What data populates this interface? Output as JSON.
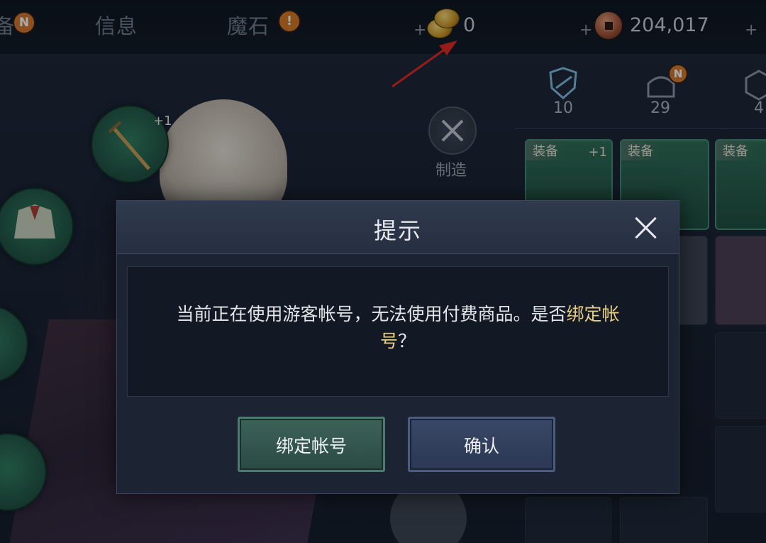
{
  "topbar": {
    "tabs": [
      {
        "label": "备"
      },
      {
        "label": "信息"
      },
      {
        "label": "魔石"
      }
    ],
    "badge_new": "N",
    "badge_alert": "!",
    "currencies": [
      {
        "icon": "gold-coin-stack-icon",
        "value": "0"
      },
      {
        "icon": "bronze-coin-icon",
        "value": "204,017"
      }
    ],
    "plus_sign": "+"
  },
  "craft": {
    "label": "制造"
  },
  "inventory": {
    "categories": [
      {
        "icon": "shield-category-icon",
        "count": "10"
      },
      {
        "icon": "anvil-category-icon",
        "count": "29",
        "badge": "N"
      },
      {
        "icon": "gem-category-icon",
        "count": "4"
      }
    ],
    "card_tag": "装备",
    "card_plus": "+1"
  },
  "equipment": {
    "plus": "+1"
  },
  "dialog": {
    "title": "提示",
    "message_plain": "当前正在使用游客帐号，无法使用付费商品。是否",
    "message_highlight_1": "绑定帐",
    "message_highlight_2": "号",
    "message_end": "？",
    "bind_button": "绑定帐号",
    "confirm_button": "确认",
    "colors": {
      "highlight": "#e6cc84",
      "bind": "#3c6258",
      "confirm": "#394866"
    }
  }
}
